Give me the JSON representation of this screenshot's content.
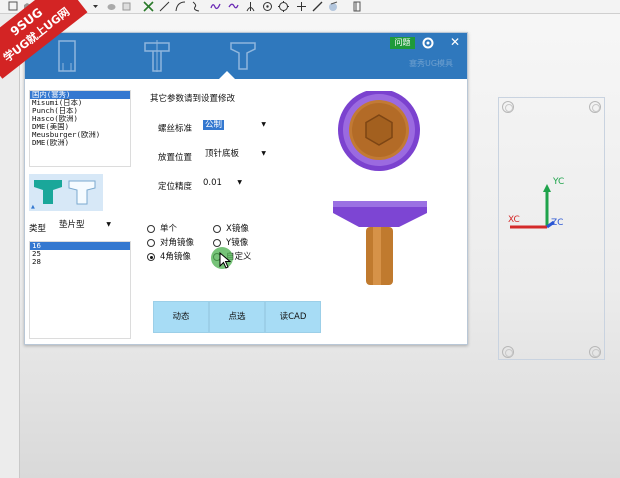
{
  "watermark": {
    "line1": "9SUG",
    "line2": "学UG就上UG网"
  },
  "toolbar": {
    "icons": [
      "select-icon",
      "cube-icon",
      "sphere-icon",
      "snap-point-icon",
      "line-icon",
      "arc-icon",
      "spline-icon",
      "curve-icon",
      "intersect-icon",
      "circle-point-icon",
      "circle-icon",
      "cross-icon",
      "slash-icon",
      "view-icon",
      "layer-icon"
    ]
  },
  "dialog": {
    "help_label": "问题",
    "brand": "塞秀UG模具",
    "tabs": [
      "tab-plate",
      "tab-side-screw",
      "tab-counterbore-screw"
    ],
    "standards": [
      "国内(塞秀)",
      "Misumi(日本)",
      "Punch(日本)",
      "Hasco(欧洲)",
      "DME(美国)",
      "Meusburger(欧洲)",
      "DME(欧洲)"
    ],
    "selected_standard_index": 0,
    "type_label": "类型",
    "type_value": "垫片型",
    "sizes": [
      "16",
      "25",
      "28"
    ],
    "selected_size_index": 0,
    "param_hint": "其它参数请到设置修改",
    "params": {
      "screw_std_label": "螺丝标准",
      "screw_std_value": "公制",
      "position_label": "放置位置",
      "position_value": "顶针底板",
      "precision_label": "定位精度",
      "precision_value": "0.01"
    },
    "radios": {
      "single": "单个",
      "x_mirror": "X镜像",
      "diag_mirror": "对角镜像",
      "y_mirror": "Y镜像",
      "four_corner": "4角镜像",
      "custom": "自定义",
      "selected": "four_corner"
    },
    "buttons": {
      "dynamic": "动态",
      "point": "点选",
      "read_cad": "读CAD"
    },
    "colors": {
      "header": "#2f78bd",
      "help": "#1f9a3a",
      "button": "#a7dcf5",
      "bolt_head": "#8a53d6",
      "bolt_body": "#c07a2e"
    }
  },
  "viewport": {
    "axes": {
      "x_label": "XC",
      "y_label": "YC",
      "z_label": "ZC"
    }
  }
}
